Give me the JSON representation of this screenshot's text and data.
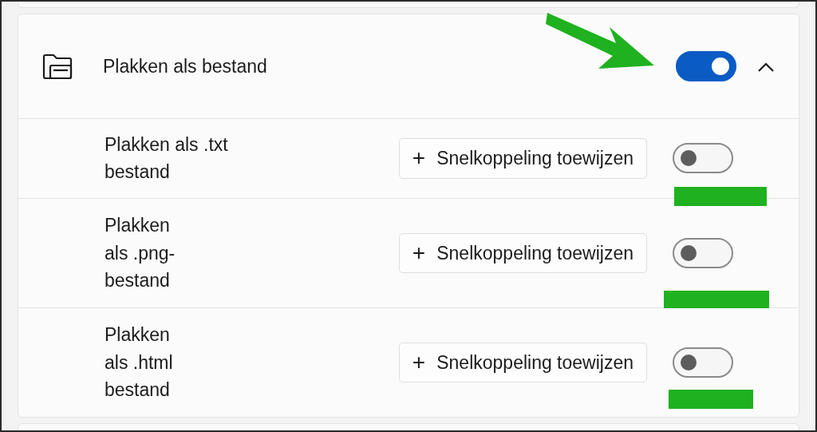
{
  "group": {
    "title": "Plakken als bestand",
    "on": true,
    "expanded": true,
    "options": [
      {
        "label_lines": [
          "Plakken als .txt",
          "bestand"
        ],
        "button": "Snelkoppeling toewijzen",
        "button_icon": "+",
        "on": false
      },
      {
        "label_lines": [
          "Plakken",
          "als .png-",
          "bestand"
        ],
        "button": "Snelkoppeling toewijzen",
        "button_icon": "+",
        "on": false
      },
      {
        "label_lines": [
          "Plakken",
          "als .html",
          "bestand"
        ],
        "button": "Snelkoppeling toewijzen",
        "button_icon": "+",
        "on": false
      }
    ]
  }
}
